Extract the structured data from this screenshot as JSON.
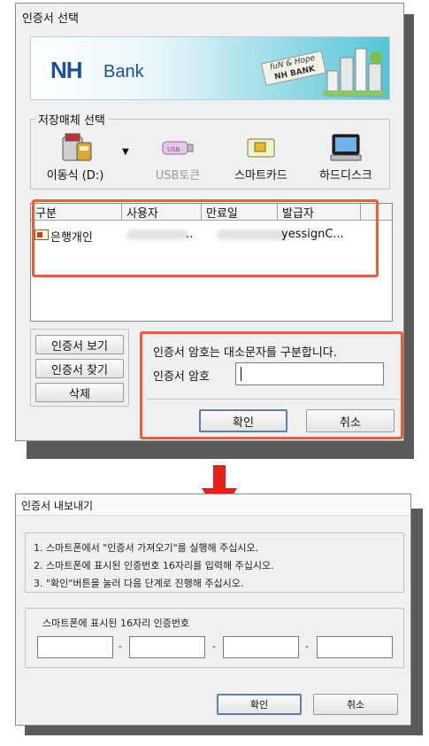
{
  "dialog1": {
    "title": "인증서 선택",
    "banner": {
      "logo_nh": "NH",
      "logo_bank": "Bank",
      "tagline_1": "fuN & Hope",
      "tagline_2": "NH BANK"
    },
    "storage": {
      "legend": "저장매체 선택",
      "items": [
        {
          "label": "이동식 (D:)",
          "icon": "removable-disk-icon",
          "enabled": true
        },
        {
          "label": "USB토큰",
          "icon": "usb-token-icon",
          "enabled": false
        },
        {
          "label": "스마트카드",
          "icon": "smart-card-icon",
          "enabled": true
        },
        {
          "label": "하드디스크",
          "icon": "hard-disk-icon",
          "enabled": true
        }
      ]
    },
    "cert_list": {
      "columns": [
        "구분",
        "사용자",
        "만료일",
        "발급자"
      ],
      "rows": [
        {
          "type": "은행개인",
          "user": "..",
          "expiry": "",
          "issuer": "yessignC..."
        }
      ]
    },
    "buttons": {
      "view": "인증서 보기",
      "find": "인증서 찾기",
      "delete": "삭제",
      "ok": "확인",
      "cancel": "취소"
    },
    "password": {
      "notice": "인증서 암호는 대소문자를 구분합니다.",
      "label": "인증서 암호",
      "value": ""
    }
  },
  "dialog2": {
    "title": "인증서 내보내기",
    "steps": [
      "1. 스마트폰에서 \"인증서 가져오기\"를 실행해 주십시오.",
      "2. 스마트폰에 표시된 인증번호 16자리를 입력해 주십시오.",
      "3. \"확인\"버튼을 눌러 다음 단계로 진행해 주십시오."
    ],
    "code_legend": "스마트폰에 표시된 16자리 인증번호",
    "separator": "-",
    "code_inputs": [
      "",
      "",
      "",
      ""
    ],
    "buttons": {
      "ok": "확인",
      "cancel": "취소"
    }
  },
  "colors": {
    "highlight": "#ef5b34",
    "arrow": "#e8201c",
    "nh_blue": "#1c4fa3",
    "banner_teal": "#3ab5c8"
  }
}
